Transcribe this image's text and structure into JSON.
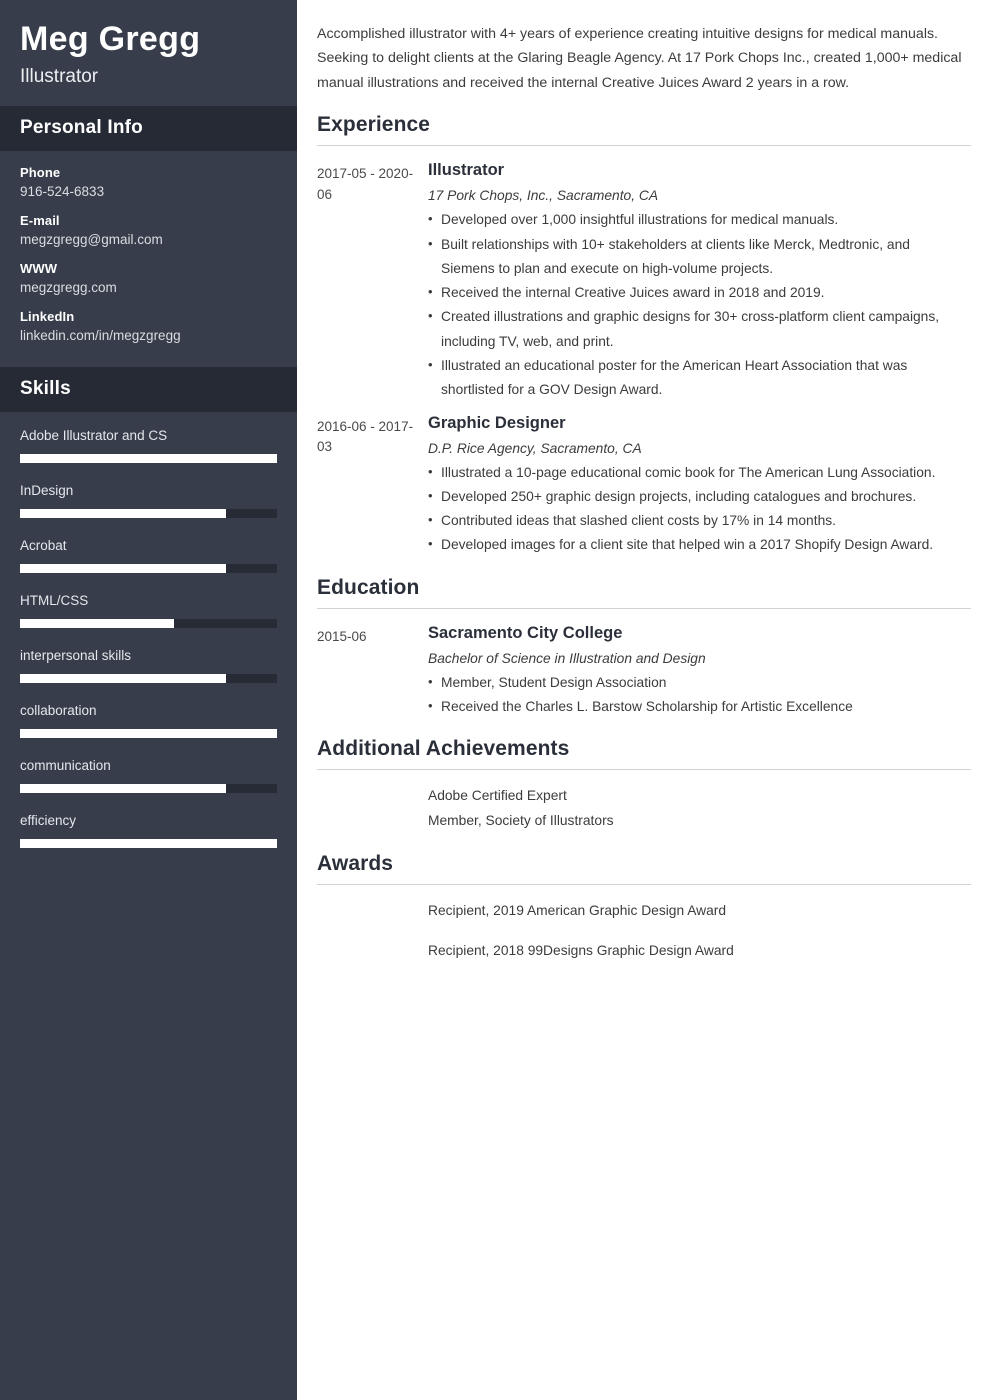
{
  "sidebar": {
    "name": "Meg Gregg",
    "job_title": "Illustrator",
    "personal_info": {
      "heading": "Personal Info",
      "items": [
        {
          "label": "Phone",
          "value": "916-524-6833"
        },
        {
          "label": "E-mail",
          "value": "megzgregg@gmail.com"
        },
        {
          "label": "WWW",
          "value": "megzgregg.com"
        },
        {
          "label": "LinkedIn",
          "value": "linkedin.com/in/megzgregg"
        }
      ]
    },
    "skills": {
      "heading": "Skills",
      "items": [
        {
          "name": "Adobe Illustrator and CS",
          "level": 100
        },
        {
          "name": "InDesign",
          "level": 80
        },
        {
          "name": "Acrobat",
          "level": 80
        },
        {
          "name": "HTML/CSS",
          "level": 60
        },
        {
          "name": "interpersonal skills",
          "level": 80
        },
        {
          "name": "collaboration",
          "level": 100
        },
        {
          "name": "communication",
          "level": 80
        },
        {
          "name": "efficiency",
          "level": 100
        }
      ]
    },
    "colors": {
      "background": "#373d4a",
      "header_background": "#252a35",
      "bar_fill": "#ffffff",
      "bar_track": "#262b36"
    }
  },
  "main": {
    "summary": "Accomplished illustrator with 4+ years of experience creating intuitive designs for medical manuals. Seeking to delight clients at the Glaring Beagle Agency. At 17 Pork Chops Inc., created 1,000+ medical manual illustrations and received the internal Creative Juices Award 2 years in a row.",
    "experience": {
      "heading": "Experience",
      "entries": [
        {
          "date": "2017-05 - 2020-06",
          "title": "Illustrator",
          "subtitle": "17 Pork Chops, Inc., Sacramento, CA",
          "bullets": [
            "Developed over 1,000 insightful illustrations for medical manuals.",
            "Built relationships with 10+ stakeholders at clients like Merck, Medtronic, and Siemens to plan and execute on high-volume projects.",
            "Received the internal Creative Juices award in 2018 and 2019.",
            "Created illustrations and graphic designs for 30+ cross-platform client campaigns, including TV, web, and print.",
            "Illustrated an educational poster for the American Heart Association that was shortlisted for a GOV Design Award."
          ]
        },
        {
          "date": "2016-06 - 2017-03",
          "title": "Graphic Designer",
          "subtitle": "D.P. Rice Agency, Sacramento, CA",
          "bullets": [
            "Illustrated a 10-page educational comic book for The American Lung Association.",
            "Developed 250+ graphic design projects, including catalogues and brochures.",
            "Contributed ideas that slashed client costs by 17% in 14 months.",
            "Developed images for a client site that helped win a 2017 Shopify Design Award."
          ]
        }
      ]
    },
    "education": {
      "heading": "Education",
      "entries": [
        {
          "date": "2015-06",
          "title": "Sacramento City College",
          "subtitle": "Bachelor of Science in Illustration and Design",
          "bullets": [
            "Member, Student Design Association",
            "Received the Charles L. Barstow Scholarship for Artistic Excellence"
          ]
        }
      ]
    },
    "additional_achievements": {
      "heading": "Additional Achievements",
      "items": [
        "Adobe Certified Expert",
        "Member, Society of Illustrators"
      ]
    },
    "awards": {
      "heading": "Awards",
      "items": [
        "Recipient, 2019 American Graphic Design Award",
        "Recipient, 2018 99Designs Graphic Design Award"
      ]
    }
  }
}
